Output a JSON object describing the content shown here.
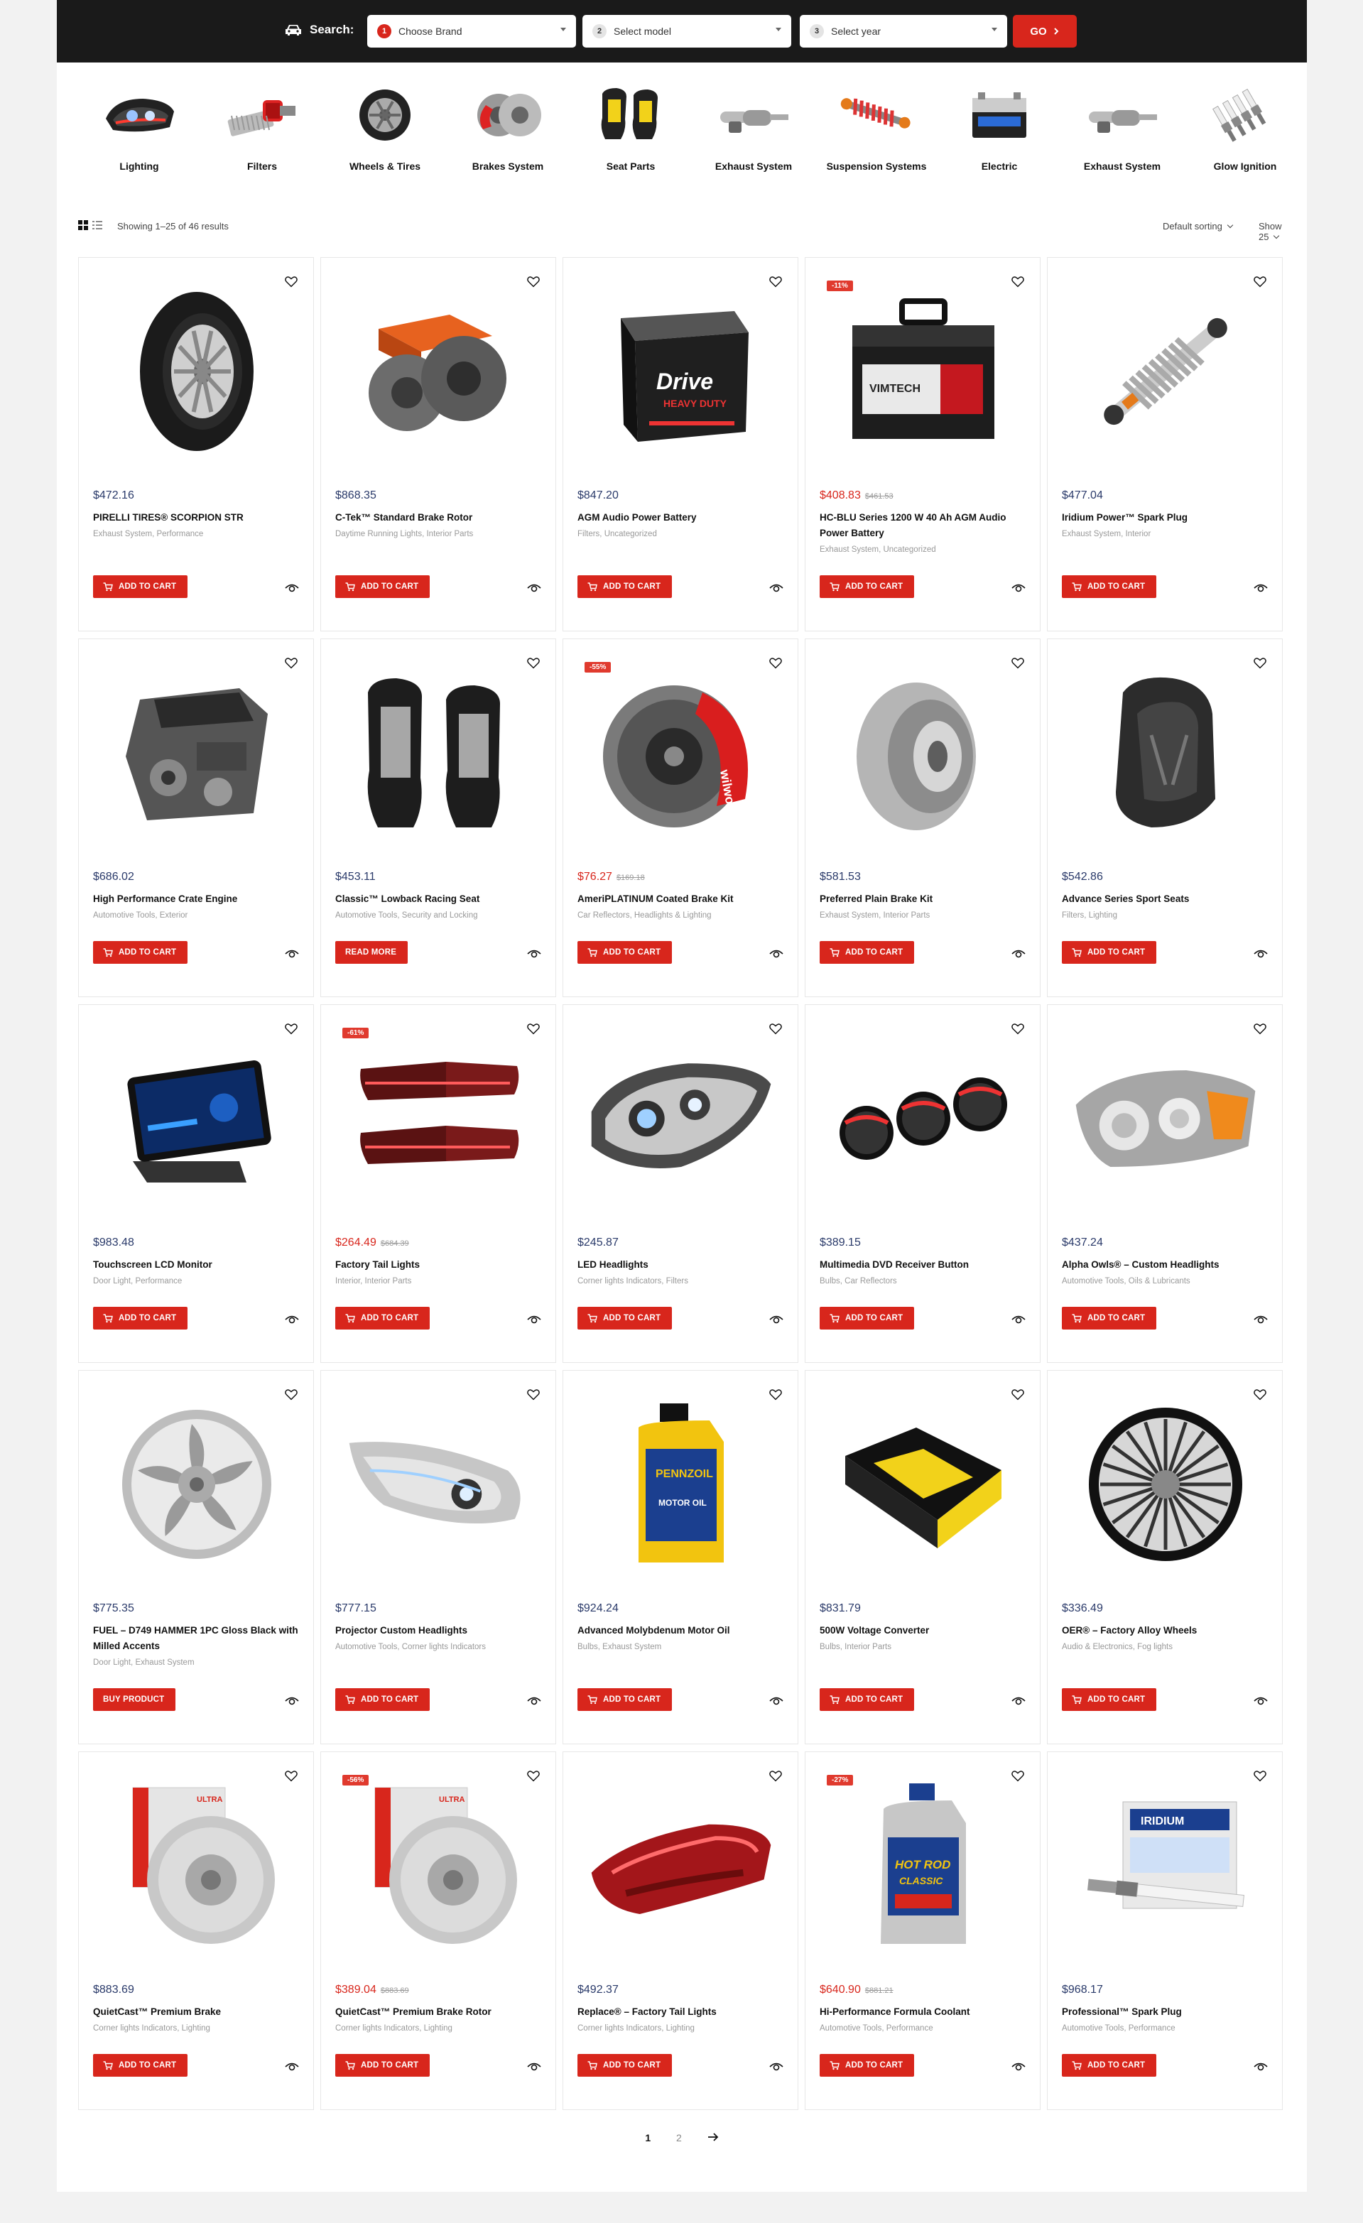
{
  "search": {
    "label": "Search:",
    "brand_num": "1",
    "brand_placeholder": "Choose Brand",
    "model_num": "2",
    "model_placeholder": "Select model",
    "year_num": "3",
    "year_placeholder": "Select year",
    "go_label": "GO"
  },
  "categories": [
    {
      "label": "Lighting",
      "icon": "headlight-icon"
    },
    {
      "label": "Filters",
      "icon": "air-filter-icon"
    },
    {
      "label": "Wheels & Tires",
      "icon": "wheel-icon"
    },
    {
      "label": "Brakes System",
      "icon": "brake-disc-icon"
    },
    {
      "label": "Seat Parts",
      "icon": "car-seat-icon"
    },
    {
      "label": "Exhaust System",
      "icon": "exhaust-icon"
    },
    {
      "label": "Suspension Systems",
      "icon": "suspension-icon"
    },
    {
      "label": "Electric",
      "icon": "battery-icon"
    },
    {
      "label": "Exhaust System",
      "icon": "exhaust-icon"
    },
    {
      "label": "Glow Ignition",
      "icon": "spark-plug-icon"
    }
  ],
  "toolbar": {
    "showing": "Showing 1–25 of 46 results",
    "sorting": "Default sorting",
    "show": "Show 25"
  },
  "products": [
    {
      "price": "$472.16",
      "title": "PIRELLI TIRES® SCORPION STR",
      "cats": "Exhaust System, Performance",
      "button": "ADD TO CART",
      "img": "tire"
    },
    {
      "price": "$868.35",
      "title": "C-Tek™ Standard Brake Rotor",
      "cats": "Daytime Running Lights, Interior Parts",
      "button": "ADD TO CART",
      "img": "rotorbox"
    },
    {
      "price": "$847.20",
      "title": "AGM Audio Power Battery",
      "cats": "Filters, Uncategorized",
      "button": "ADD TO CART",
      "img": "battery1"
    },
    {
      "price": "$408.83",
      "old": "$461.53",
      "badge": "-11%",
      "title": "HC-BLU Series 1200 W 40 Ah AGM Audio Power Battery",
      "cats": "Exhaust System, Uncategorized",
      "button": "ADD TO CART",
      "img": "battery2"
    },
    {
      "price": "$477.04",
      "title": "Iridium Power™ Spark Plug",
      "cats": "Exhaust System, Interior",
      "button": "ADD TO CART",
      "img": "shock"
    },
    {
      "price": "$686.02",
      "title": "High Performance Crate Engine",
      "cats": "Automotive Tools, Exterior",
      "button": "ADD TO CART",
      "img": "engine"
    },
    {
      "price": "$453.11",
      "title": "Classic™ Lowback Racing Seat",
      "cats": "Automotive Tools, Security and Locking",
      "button": "READ MORE",
      "img": "seats"
    },
    {
      "price": "$76.27",
      "old": "$169.18",
      "badge": "-55%",
      "title": "AmeriPLATINUM Coated Brake Kit",
      "cats": "Car Reflectors, Headlights & Lighting",
      "button": "ADD TO CART",
      "img": "brakekit"
    },
    {
      "price": "$581.53",
      "title": "Preferred Plain Brake Kit",
      "cats": "Exhaust System, Interior Parts",
      "button": "ADD TO CART",
      "img": "drum"
    },
    {
      "price": "$542.86",
      "title": "Advance Series Sport Seats",
      "cats": "Filters, Lighting",
      "button": "ADD TO CART",
      "img": "childseat"
    },
    {
      "price": "$983.48",
      "title": "Touchscreen LCD Monitor",
      "cats": "Door Light, Performance",
      "button": "ADD TO CART",
      "img": "monitor"
    },
    {
      "price": "$264.49",
      "old": "$684.39",
      "badge": "-61%",
      "title": "Factory Tail Lights",
      "cats": "Interior, Interior Parts",
      "button": "ADD TO CART",
      "img": "taillights"
    },
    {
      "price": "$245.87",
      "title": "LED Headlights",
      "cats": "Corner lights Indicators, Filters",
      "button": "ADD TO CART",
      "img": "headlight"
    },
    {
      "price": "$389.15",
      "title": "Multimedia DVD Receiver Button",
      "cats": "Bulbs, Car Reflectors",
      "button": "ADD TO CART",
      "img": "knobs"
    },
    {
      "price": "$437.24",
      "title": "Alpha Owls® – Custom Headlights",
      "cats": "Automotive Tools, Oils & Lubricants",
      "button": "ADD TO CART",
      "img": "headlight2"
    },
    {
      "price": "$775.35",
      "title": "FUEL – D749 HAMMER 1PC Gloss Black with Milled Accents",
      "cats": "Door Light, Exhaust System",
      "button": "BUY PRODUCT",
      "img": "rim"
    },
    {
      "price": "$777.15",
      "title": "Projector Custom Headlights",
      "cats": "Automotive Tools, Corner lights Indicators",
      "button": "ADD TO CART",
      "img": "headlight3"
    },
    {
      "price": "$924.24",
      "title": "Advanced Molybdenum Motor Oil",
      "cats": "Bulbs, Exhaust System",
      "button": "ADD TO CART",
      "img": "oil"
    },
    {
      "price": "$831.79",
      "title": "500W Voltage Converter",
      "cats": "Bulbs, Interior Parts",
      "button": "ADD TO CART",
      "img": "obd"
    },
    {
      "price": "$336.49",
      "title": "OER® – Factory Alloy Wheels",
      "cats": "Audio & Electronics, Fog lights",
      "button": "ADD TO CART",
      "img": "spokewheel"
    },
    {
      "price": "$883.69",
      "title": "QuietCast™ Premium Brake",
      "cats": "Corner lights Indicators, Lighting",
      "button": "ADD TO CART",
      "img": "disc"
    },
    {
      "price": "$389.04",
      "old": "$883.69",
      "badge": "-56%",
      "title": "QuietCast™ Premium Brake Rotor",
      "cats": "Corner lights Indicators, Lighting",
      "button": "ADD TO CART",
      "img": "disc"
    },
    {
      "price": "$492.37",
      "title": "Replace® – Factory Tail Lights",
      "cats": "Corner lights Indicators, Lighting",
      "button": "ADD TO CART",
      "img": "taillight2"
    },
    {
      "price": "$640.90",
      "old": "$881.21",
      "badge": "-27%",
      "title": "Hi-Performance Formula Coolant",
      "cats": "Automotive Tools, Performance",
      "button": "ADD TO CART",
      "img": "coolant"
    },
    {
      "price": "$968.17",
      "title": "Professional™ Spark Plug",
      "cats": "Automotive Tools, Performance",
      "button": "ADD TO CART",
      "img": "sparkplug"
    }
  ],
  "pagination": {
    "pages": [
      "1",
      "2"
    ],
    "current": "1"
  },
  "colors": {
    "accent": "#d8261c",
    "dark": "#1a1a1a",
    "price": "#2a3a6a"
  }
}
